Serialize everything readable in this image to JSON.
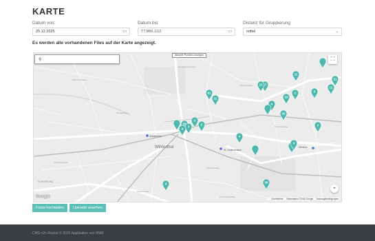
{
  "page": {
    "title": "KARTE"
  },
  "filters": {
    "date_from": {
      "label": "Datum von:",
      "value": "25.12.2025"
    },
    "date_to": {
      "label": "Datum bis:",
      "placeholder": "TT.MM.JJJJ"
    },
    "distance": {
      "label": "Distanz für Gruppierung",
      "selected": "mittel"
    }
  },
  "info": "Es werden alle vorhandenen Files auf der Karte angezeigt.",
  "map": {
    "current_position_label": "Aktuelle Position anzeigen",
    "google_logo": "Google",
    "footer_links": [
      "Kurzbefehle",
      "Kartendaten ©2026 Google",
      "Nutzungsbedingungen"
    ],
    "place_labels": [
      "Winterthur",
      "St. Gallerstrasse",
      "Hünikon",
      "SCHWIESTAL"
    ],
    "marker_color": "#4cb8ad",
    "markers": [
      {
        "label": ""
      },
      {
        "label": "11"
      },
      {
        "label": "21"
      },
      {
        "label": "11"
      },
      {
        "label": "17"
      },
      {
        "label": "11"
      },
      {
        "label": "3"
      },
      {
        "label": "13"
      },
      {
        "label": "2"
      },
      {
        "label": "61"
      },
      {
        "label": "11"
      },
      {
        "label": "4"
      },
      {
        "label": ""
      },
      {
        "label": "33"
      },
      {
        "label": "3"
      },
      {
        "label": ""
      },
      {
        "label": "32"
      },
      {
        "label": "3"
      },
      {
        "label": "2"
      },
      {
        "label": "3"
      },
      {
        "label": "4"
      },
      {
        "label": "4"
      },
      {
        "label": ""
      },
      {
        "label": ""
      },
      {
        "label": "3"
      },
      {
        "label": "4"
      },
      {
        "label": "39"
      }
    ]
  },
  "buttons": {
    "upload_photos": "Fotos hochladen",
    "show_uploads": "Uploads ansehen"
  },
  "footer": {
    "text": "CMS n2n Rocket © 2026 Applikation von HNM"
  }
}
